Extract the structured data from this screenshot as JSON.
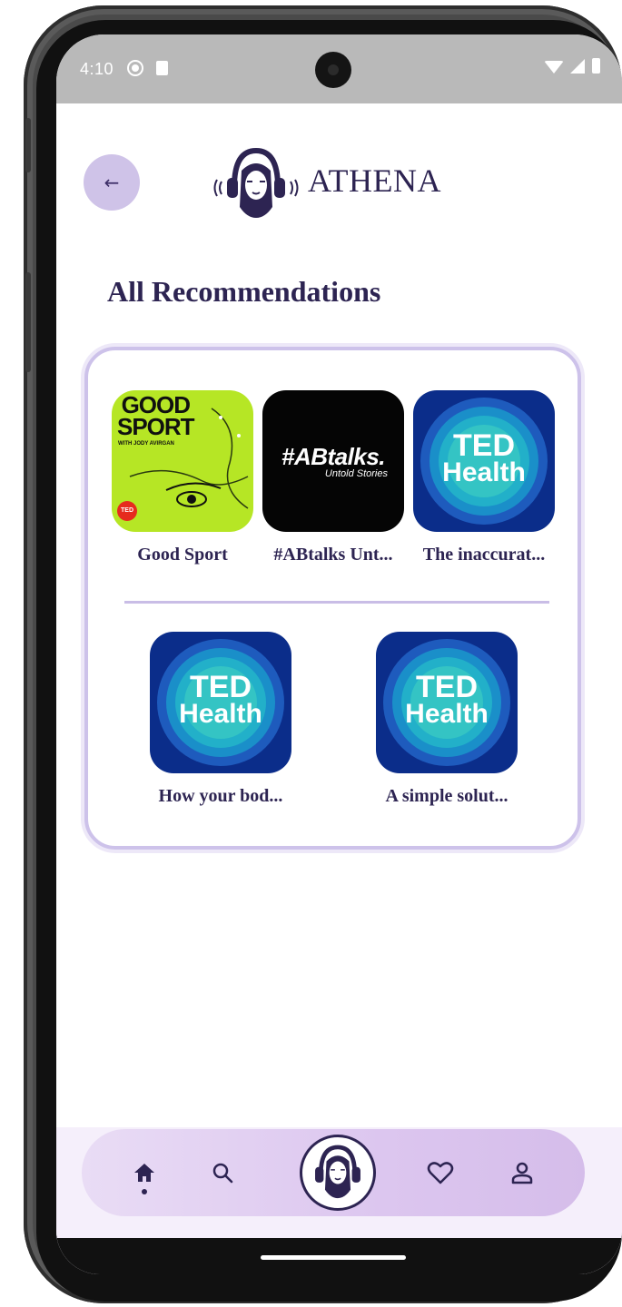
{
  "status_bar": {
    "time": "4:10"
  },
  "header": {
    "app_title": "ATHENA",
    "back_icon": "arrow-left-icon",
    "logo_icon": "athena-headphones-logo"
  },
  "section": {
    "title": "All Recommendations"
  },
  "recommendations": [
    {
      "title": "Good Sport",
      "cover_main": "GOOD\nSPORT",
      "cover_sub": "WITH JODY AVIRGAN",
      "cover_badge": "TED"
    },
    {
      "title": "#ABtalks Unt...",
      "cover_main": "#ABtalks.",
      "cover_sub": "Untold Stories"
    },
    {
      "title": "The inaccurat...",
      "cover_line1": "TED",
      "cover_line2": "Health"
    },
    {
      "title": "How your bod...",
      "cover_line1": "TED",
      "cover_line2": "Health"
    },
    {
      "title": "A simple solut...",
      "cover_line1": "TED",
      "cover_line2": "Health"
    }
  ],
  "bottom_nav": [
    {
      "name": "home",
      "icon": "home-icon",
      "active": true
    },
    {
      "name": "search",
      "icon": "search-icon"
    },
    {
      "name": "athena",
      "icon": "athena-logo-icon"
    },
    {
      "name": "favorites",
      "icon": "heart-icon"
    },
    {
      "name": "profile",
      "icon": "user-icon"
    }
  ],
  "colors": {
    "accent": "#cfc3e8",
    "primary_text": "#2d2452",
    "card_border": "#cdc2ea",
    "ted_blue": "#0b2d8a",
    "goodsport_green": "#b6e625"
  }
}
